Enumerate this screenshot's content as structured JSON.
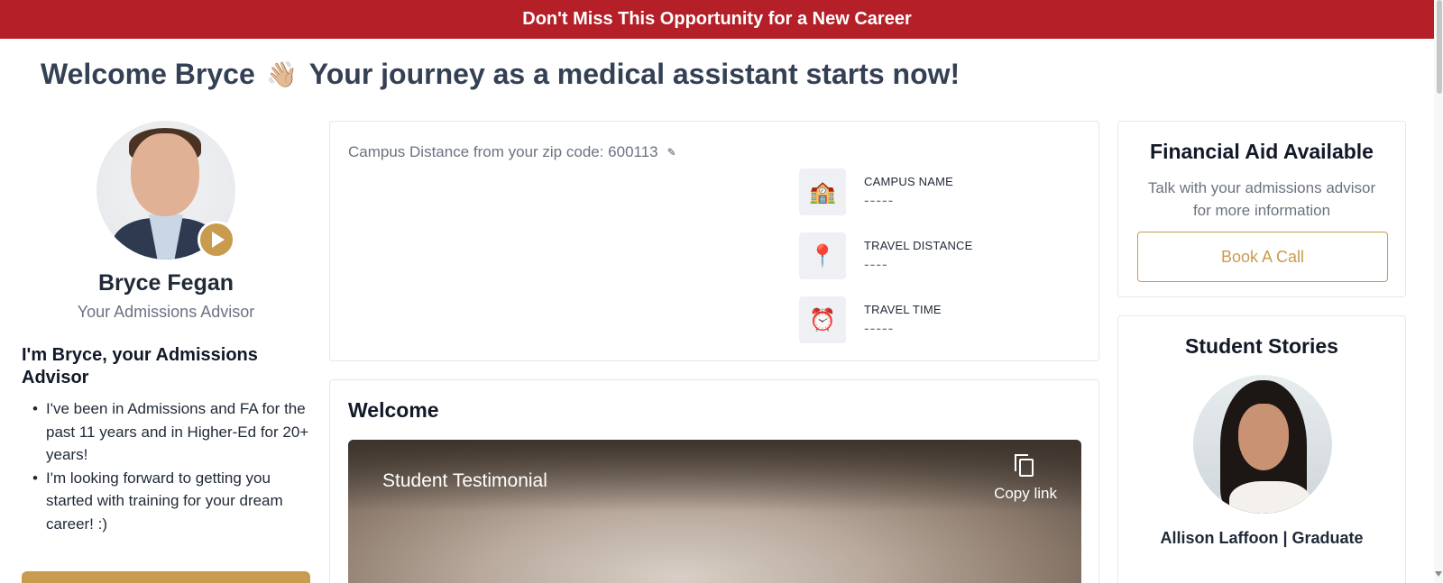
{
  "banner": {
    "text": "Don't Miss This Opportunity for a New Career"
  },
  "header": {
    "welcome_prefix": "Welcome Bryce",
    "wave_emoji": "👋🏼",
    "welcome_suffix": "Your journey as a medical assistant starts now!"
  },
  "advisor": {
    "name": "Bryce Fegan",
    "role": "Your Admissions Advisor",
    "intro_heading": "I'm Bryce, your Admissions Advisor",
    "bullets": [
      "I've been in Admissions and FA for the past 11 years and in Higher-Ed for 20+ years!",
      "I'm looking forward to getting you started with  training for your dream career! :)"
    ]
  },
  "campus": {
    "zip_label": "Campus Distance from your zip code: 600113",
    "edit_icon": "pencil-icon",
    "rows": [
      {
        "icon": "🏫",
        "icon_name": "school-icon",
        "label": "CAMPUS NAME",
        "value": "-----"
      },
      {
        "icon": "📍",
        "icon_name": "pushpin-icon",
        "label": "TRAVEL DISTANCE",
        "value": "----"
      },
      {
        "icon": "⏰",
        "icon_name": "alarm-clock-icon",
        "label": "TRAVEL TIME",
        "value": "-----"
      }
    ]
  },
  "welcome_section": {
    "heading": "Welcome",
    "video_title": "Student Testimonial",
    "copy_link_label": "Copy link"
  },
  "financial_aid": {
    "title": "Financial Aid Available",
    "subtitle": "Talk with your admissions advisor for more information",
    "button_label": "Book A Call"
  },
  "stories": {
    "title": "Student Stories",
    "student_name": "Allison Laffoon | Graduate"
  },
  "colors": {
    "banner_red": "#b51f27",
    "accent_gold": "#c89b4f",
    "heading_slate": "#344054"
  }
}
